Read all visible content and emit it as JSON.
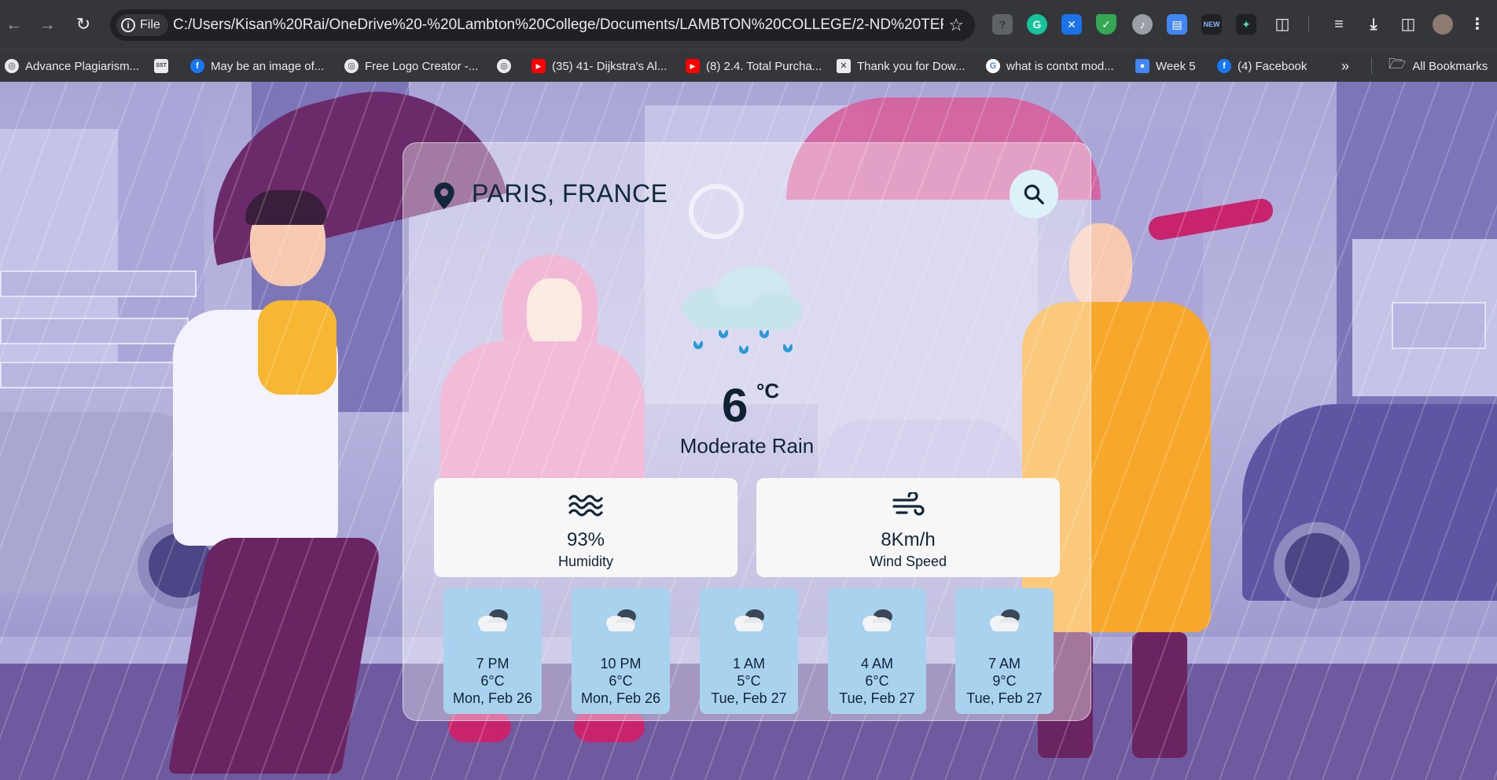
{
  "browser": {
    "file_chip": "File",
    "url": "C:/Users/Kisan%20Rai/OneDrive%20-%20Lambton%20College/Documents/LAMBTON%20COLLEGE/2-ND%20TERM/FRONT-...",
    "extensions": [
      "puzzle-extension",
      "grammarly-extension",
      "x-extension",
      "shield-extension",
      "media-extension",
      "docs-extension",
      "new-extension",
      "spark-extension"
    ],
    "bookmarks": [
      {
        "label": "Advance Plagiarism..."
      },
      {
        "label": ""
      },
      {
        "label": "May be an image of..."
      },
      {
        "label": "Free Logo Creator -..."
      },
      {
        "label": ""
      },
      {
        "label": "(35) 41- Dijkstra's Al..."
      },
      {
        "label": "(8) 2.4. Total Purcha..."
      },
      {
        "label": "Thank you for Dow..."
      },
      {
        "label": "what is contxt mod..."
      },
      {
        "label": "Week 5"
      },
      {
        "label": "(4) Facebook"
      }
    ],
    "overflow": "»",
    "all_bookmarks": "All Bookmarks"
  },
  "weather": {
    "location": "PARIS, FRANCE",
    "temperature": "6",
    "unit": "°C",
    "condition": "Moderate Rain",
    "humidity": {
      "value": "93%",
      "label": "Humidity"
    },
    "wind": {
      "value": "8Km/h",
      "label": "Wind Speed"
    },
    "forecast": [
      {
        "time": "7 PM",
        "temp": "6°C",
        "date": "Mon, Feb 26"
      },
      {
        "time": "10 PM",
        "temp": "6°C",
        "date": "Mon, Feb 26"
      },
      {
        "time": "1 AM",
        "temp": "5°C",
        "date": "Tue, Feb 27"
      },
      {
        "time": "4 AM",
        "temp": "6°C",
        "date": "Tue, Feb 27"
      },
      {
        "time": "7 AM",
        "temp": "9°C",
        "date": "Tue, Feb 27"
      }
    ]
  },
  "colors": {
    "chrome_bg": "#35363a",
    "card_bg": "rgba(255,255,255,0.38)",
    "forecast_bg": "#a9d2ee",
    "text_dark": "#102436",
    "search_bg": "#ddf1f8"
  }
}
